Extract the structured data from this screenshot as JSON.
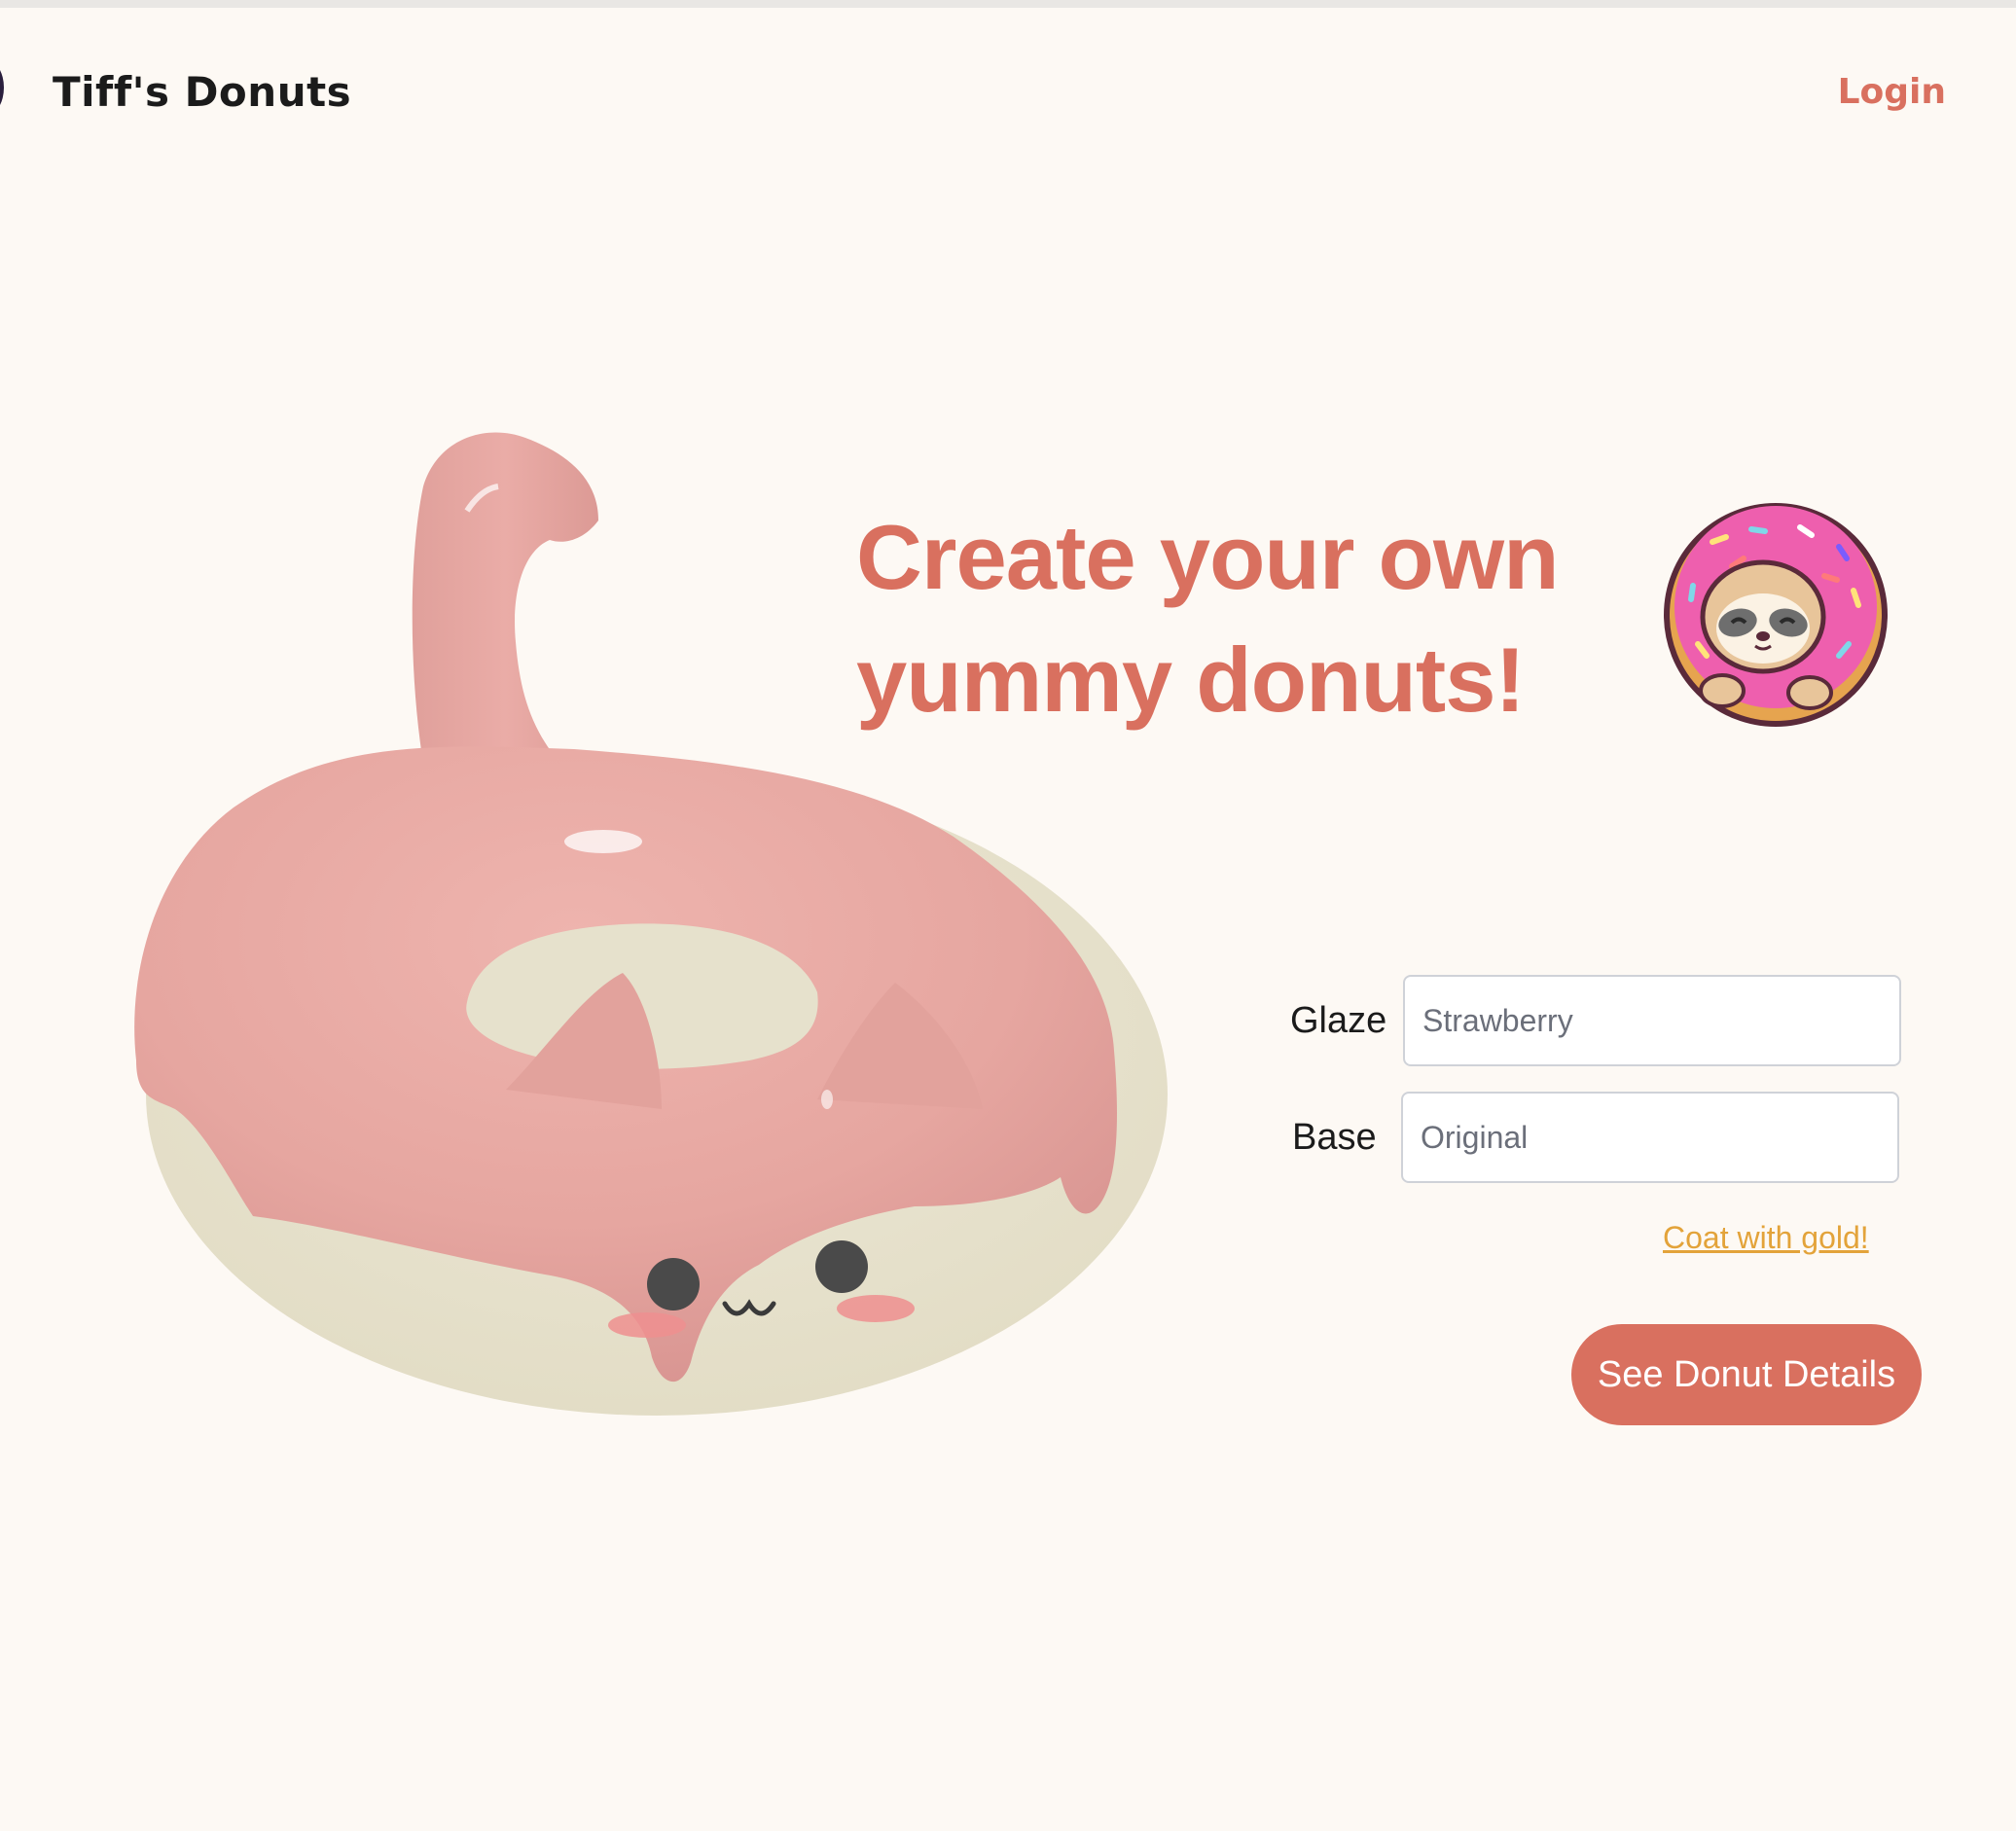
{
  "header": {
    "brand": "Tiff's Donuts",
    "login_label": "Login"
  },
  "hero": {
    "headline_line1": "Create your own",
    "headline_line2": "yummy donuts!",
    "donut_illustration": "pink-glazed-cat-donut",
    "sloth_illustration": "sloth-in-donut-sticker"
  },
  "form": {
    "glaze_label": "Glaze",
    "glaze_placeholder": "Strawberry",
    "base_label": "Base",
    "base_placeholder": "Original",
    "gold_link": "Coat with gold!",
    "submit_label": "See Donut Details"
  },
  "colors": {
    "background": "#fdf9f4",
    "accent": "#d9705f",
    "gold_link": "#e3a33a",
    "glaze_pink": "#e7a9a3",
    "dough_cream": "#e6e1cc"
  }
}
